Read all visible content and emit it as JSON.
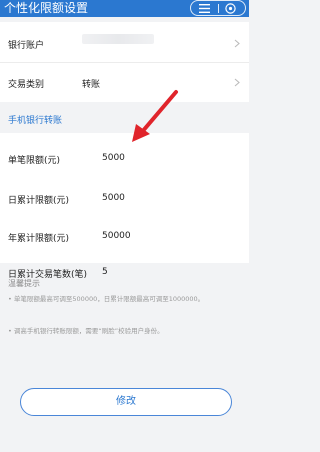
{
  "header": {
    "title": "个性化限额设置",
    "menu_icon": "menu-icon",
    "close_icon": "close-circle-icon"
  },
  "account": {
    "label": "银行账户",
    "chevron": "chevron-right-icon"
  },
  "transaction_type": {
    "label": "交易类别",
    "value": "转账",
    "chevron": "chevron-right-icon"
  },
  "section": {
    "title": "手机银行转账"
  },
  "limits": [
    {
      "label": "单笔限额(元)",
      "value": "5000"
    },
    {
      "label": "日累计限额(元)",
      "value": "5000"
    },
    {
      "label": "年累计限额(元)",
      "value": "50000"
    },
    {
      "label": "日累计交易笔数(笔)",
      "value": "5"
    }
  ],
  "tips": {
    "title": "温馨提示",
    "items": [
      "单笔限额最高可调至500000，日累计限额最高可调至1000000。",
      "调高手机银行转账限额，需要“刷脸”校验用户身份。"
    ]
  },
  "actions": {
    "modify_label": "修改"
  },
  "colors": {
    "brand": "#2b78d0",
    "annotation_arrow": "#e0242b"
  }
}
